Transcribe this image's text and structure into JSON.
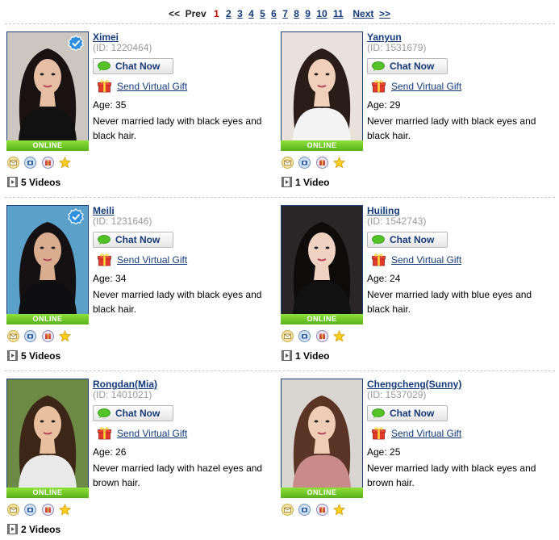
{
  "pager": {
    "prev_arrows": "<<",
    "prev_label": "Prev",
    "current": "1",
    "pages": [
      "2",
      "3",
      "4",
      "5",
      "6",
      "7",
      "8",
      "9",
      "10",
      "11"
    ],
    "next_label": "Next",
    "next_arrows": ">>"
  },
  "common": {
    "chat_label": "Chat Now",
    "gift_label": "Send Virtual Gift",
    "online_label": "ONLINE"
  },
  "profiles": [
    {
      "name": "Ximei",
      "id": "(ID: 1220464)",
      "age": "Age: 35",
      "desc": "Never married lady with black eyes and black hair.",
      "videos": "5 Videos",
      "verified": true
    },
    {
      "name": "Yanyun",
      "id": "(ID: 1531679)",
      "age": "Age: 29",
      "desc": "Never married lady with black eyes and black hair.",
      "videos": "1 Video",
      "verified": false
    },
    {
      "name": "Meili",
      "id": "(ID: 1231646)",
      "age": "Age: 34",
      "desc": "Never married lady with black eyes and black hair.",
      "videos": "5 Videos",
      "verified": true
    },
    {
      "name": "Huiling",
      "id": "(ID: 1542743)",
      "age": "Age: 24",
      "desc": "Never married lady with blue eyes and black hair.",
      "videos": "1 Video",
      "verified": false
    },
    {
      "name": "Rongdan(Mia)",
      "id": "(ID: 1401021)",
      "age": "Age: 26",
      "desc": "Never married lady with hazel eyes and brown hair.",
      "videos": "2 Videos",
      "verified": false
    },
    {
      "name": "Chengcheng(Sunny)",
      "id": "(ID: 1537029)",
      "age": "Age: 25",
      "desc": "Never married lady with black eyes and brown hair.",
      "videos": "",
      "verified": false
    }
  ],
  "colors": {
    "link": "#123a7a",
    "online": "#6cc425",
    "current_page": "#bb0000"
  }
}
